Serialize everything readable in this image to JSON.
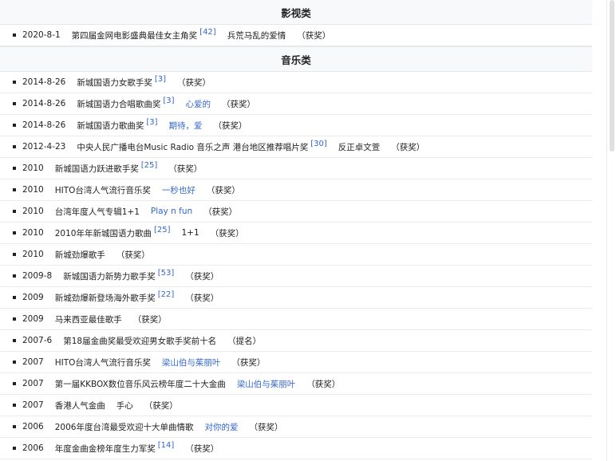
{
  "sections": [
    {
      "title": "影视类",
      "rows": [
        {
          "date": "2020-8-1",
          "award": "第四届金网电影盛典最佳女主角奖",
          "ref": "[42]",
          "work": "兵荒马乱的爱情",
          "work_link": false,
          "result": "（获奖）"
        }
      ]
    },
    {
      "title": "音乐类",
      "rows": [
        {
          "date": "2014-8-26",
          "award": "新城国语力女歌手奖",
          "ref": "[3]",
          "work": "",
          "work_link": false,
          "result": "（获奖）"
        },
        {
          "date": "2014-8-26",
          "award": "新城国语力合唱歌曲奖",
          "ref": "[3]",
          "work": "心爱的",
          "work_link": true,
          "result": "（获奖）"
        },
        {
          "date": "2014-8-26",
          "award": "新城国语力歌曲奖",
          "ref": "[3]",
          "work": "期待，爱",
          "work_link": true,
          "result": "（获奖）"
        },
        {
          "date": "2012-4-23",
          "award": "中央人民广播电台Music Radio 音乐之声 港台地区推荐唱片奖",
          "ref": "[30]",
          "work": "反正卓文萱",
          "work_link": false,
          "result": "（获奖）"
        },
        {
          "date": "2010",
          "award": "新城国语力跃进歌手奖",
          "ref": "[25]",
          "work": "",
          "work_link": false,
          "result": "（获奖）"
        },
        {
          "date": "2010",
          "award": "HITO台湾人气流行音乐奖",
          "ref": "",
          "work": "一秒也好",
          "work_link": true,
          "result": "（获奖）"
        },
        {
          "date": "2010",
          "award": "台湾年度人气专辑1+1",
          "ref": "",
          "work": "Play n fun",
          "work_link": true,
          "result": "（获奖）"
        },
        {
          "date": "2010",
          "award": "2010年年新城国语力歌曲",
          "ref": "[25]",
          "work": "1+1",
          "work_link": false,
          "result": "（获奖）"
        },
        {
          "date": "2010",
          "award": "新城劲爆歌手",
          "ref": "",
          "work": "",
          "work_link": false,
          "result": "（获奖）"
        },
        {
          "date": "2009-8",
          "award": "新城国语力新势力歌手奖",
          "ref": "[53]",
          "work": "",
          "work_link": false,
          "result": "（获奖）"
        },
        {
          "date": "2009",
          "award": "新城劲爆新登场海外歌手奖",
          "ref": "[22]",
          "work": "",
          "work_link": false,
          "result": "（获奖）"
        },
        {
          "date": "2009",
          "award": "马来西亚最佳歌手",
          "ref": "",
          "work": "",
          "work_link": false,
          "result": "（获奖）"
        },
        {
          "date": "2007-6",
          "award": "第18届金曲奖最受欢迎男女歌手奖前十名",
          "ref": "",
          "work": "",
          "work_link": false,
          "result": "（提名）"
        },
        {
          "date": "2007",
          "award": "HITO台湾人气流行音乐奖",
          "ref": "",
          "work": "梁山伯与茱丽叶",
          "work_link": true,
          "result": "（获奖）"
        },
        {
          "date": "2007",
          "award": "第一届KKBOX数位音乐风云榜年度二十大金曲",
          "ref": "",
          "work": "梁山伯与茱丽叶",
          "work_link": true,
          "result": "（获奖）"
        },
        {
          "date": "2007",
          "award": "香港人气金曲",
          "ref": "",
          "work": "手心",
          "work_link": false,
          "result": "（获奖）"
        },
        {
          "date": "2006",
          "award": "2006年度台湾最受欢迎十大单曲情歌",
          "ref": "",
          "work": "对你的爱",
          "work_link": true,
          "result": "（获奖）"
        },
        {
          "date": "2006",
          "award": "年度金曲金榜年度生力军奖",
          "ref": "[14]",
          "work": "",
          "work_link": false,
          "result": "（获奖）"
        }
      ]
    }
  ]
}
